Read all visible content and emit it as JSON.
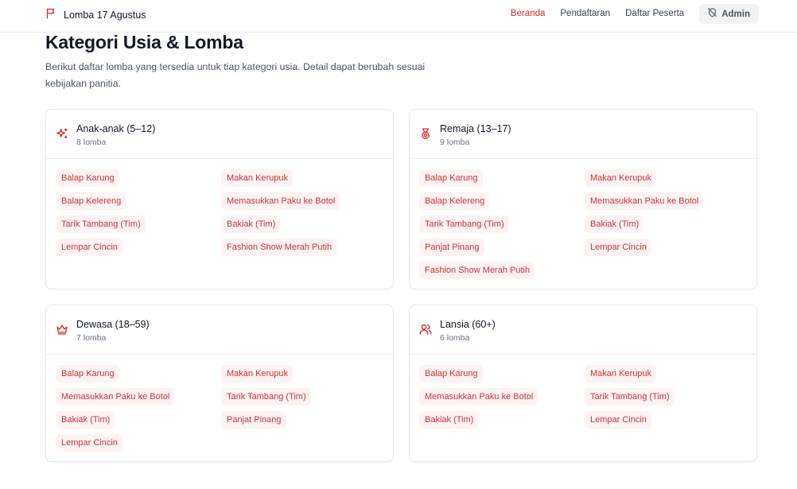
{
  "header": {
    "brand": "Lomba 17 Agustus",
    "brand_icon": "flag-icon",
    "nav": [
      "Beranda",
      "Pendaftaran",
      "Daftar Peserta"
    ],
    "active_nav": "Beranda",
    "admin_label": "Admin",
    "admin_icon": "shield-off-icon"
  },
  "page": {
    "title": "Kategori Usia & Lomba",
    "description": "Berikut daftar lomba yang tersedia untuk tiap kategori usia. Detail dapat berubah sesuai kebijakan panitia."
  },
  "colors": {
    "accent": "#dc2626",
    "tag_bg": "#fef2f2",
    "tag_text": "#c9343a"
  },
  "categories": [
    {
      "title": "Anak-anak (5–12)",
      "count": "8 lomba",
      "icon": "sparkles-icon",
      "tags": [
        "Balap Karung",
        "Makan Kerupuk",
        "Balap Kelereng",
        "Memasukkan Paku ke Botol",
        "Tarik Tambang (Tim)",
        "Bakiak (Tim)",
        "Lempar Cincin",
        "Fashion Show Merah Putih"
      ]
    },
    {
      "title": "Remaja (13–17)",
      "count": "9 lomba",
      "icon": "medal-icon",
      "tags": [
        "Balap Karung",
        "Makan Kerupuk",
        "Balap Kelereng",
        "Memasukkan Paku ke Botol",
        "Tarik Tambang (Tim)",
        "Bakiak (Tim)",
        "Panjat Pinang",
        "Lempar Cincin",
        "Fashion Show Merah Putih"
      ]
    },
    {
      "title": "Dewasa (18–59)",
      "count": "7 lomba",
      "icon": "crown-icon",
      "tags": [
        "Balap Karung",
        "Makan Kerupuk",
        "Memasukkan Paku ke Botol",
        "Tarik Tambang (Tim)",
        "Bakiak (Tim)",
        "Panjat Pinang",
        "Lempar Cincin"
      ]
    },
    {
      "title": "Lansia (60+)",
      "count": "6 lomba",
      "icon": "users-icon",
      "tags": [
        "Balap Karung",
        "Makan Kerupuk",
        "Memasukkan Paku ke Botol",
        "Tarik Tambang (Tim)",
        "Bakiak (Tim)",
        "Lempar Cincin"
      ]
    }
  ]
}
